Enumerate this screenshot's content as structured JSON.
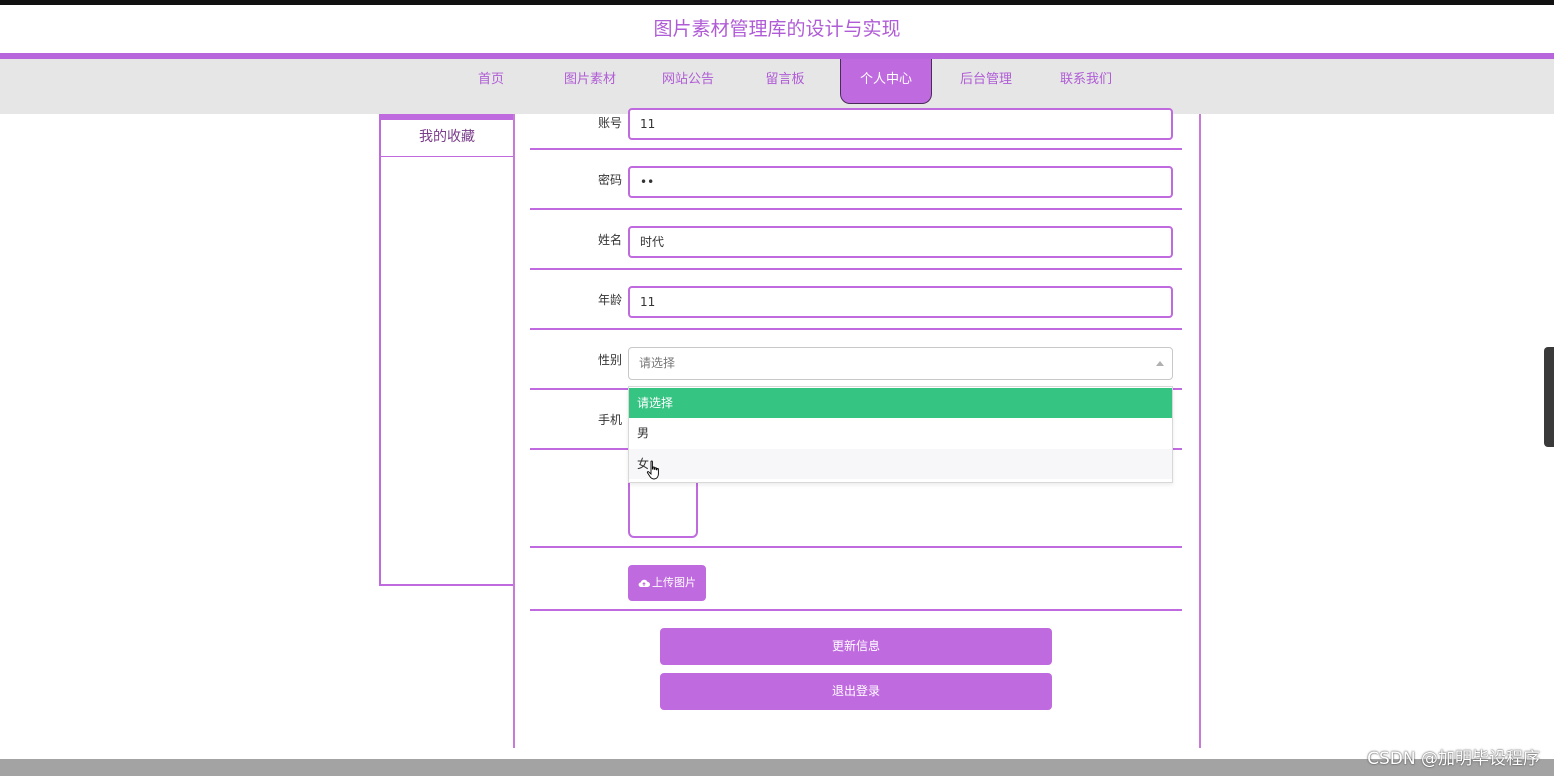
{
  "site": {
    "title": "图片素材管理库的设计与实现"
  },
  "nav": {
    "items": [
      {
        "label": "首页"
      },
      {
        "label": "图片素材"
      },
      {
        "label": "网站公告"
      },
      {
        "label": "留言板"
      },
      {
        "label": "个人中心",
        "active": true
      },
      {
        "label": "后台管理"
      },
      {
        "label": "联系我们"
      }
    ]
  },
  "sidebar": {
    "items": [
      {
        "label": "我的收藏"
      }
    ]
  },
  "form": {
    "account": {
      "label": "账号",
      "value": "11"
    },
    "password": {
      "label": "密码",
      "value": "••"
    },
    "name": {
      "label": "姓名",
      "value": "时代"
    },
    "age": {
      "label": "年龄",
      "value": "11"
    },
    "gender": {
      "label": "性别",
      "placeholder": "请选择",
      "options": [
        "请选择",
        "男",
        "女"
      ],
      "highlighted": "请选择",
      "hovered": "女"
    },
    "phone": {
      "label": "手机"
    }
  },
  "buttons": {
    "upload": "上传图片",
    "update": "更新信息",
    "logout": "退出登录"
  },
  "colors": {
    "accent": "#c06ae0",
    "select_highlight": "#36c483"
  },
  "watermark": "CSDN @加明毕设程序"
}
